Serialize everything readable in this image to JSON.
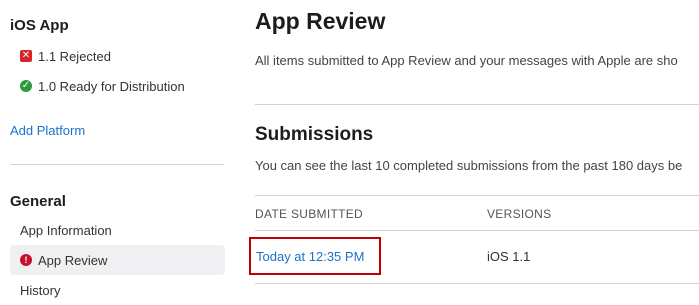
{
  "sidebar": {
    "app_section_title": "iOS App",
    "versions": [
      {
        "label": "1.1 Rejected",
        "status": "rejected",
        "icon": "rejected-icon",
        "color": "#d7262b"
      },
      {
        "label": "1.0 Ready for Distribution",
        "status": "ready",
        "icon": "check-circle-icon",
        "color": "#2e9a3f"
      }
    ],
    "add_platform_label": "Add Platform",
    "general_title": "General",
    "nav_items": [
      {
        "label": "App Information",
        "active": false
      },
      {
        "label": "App Review",
        "active": true,
        "icon": "alert-icon"
      },
      {
        "label": "History",
        "active": false
      }
    ]
  },
  "main": {
    "title": "App Review",
    "description": "All items submitted to App Review and your messages with Apple are sho",
    "submissions": {
      "heading": "Submissions",
      "description": "You can see the last 10 completed submissions from the past 180 days be",
      "columns": [
        "DATE SUBMITTED",
        "VERSIONS"
      ],
      "rows": [
        {
          "date": "Today at 12:35 PM",
          "versions": "iOS 1.1"
        }
      ]
    }
  },
  "colors": {
    "link": "#1a73c8",
    "highlight_border": "#c00000",
    "active_nav_bg": "#f0f0f2"
  }
}
